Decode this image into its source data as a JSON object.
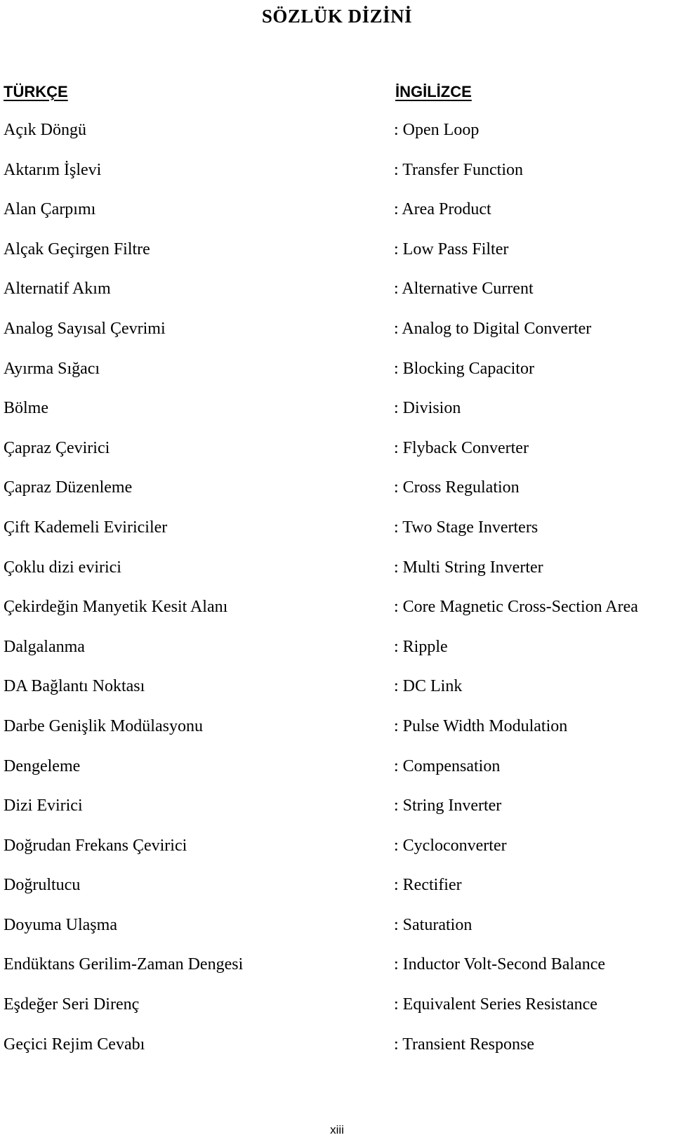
{
  "document": {
    "title": "SÖZLÜK DİZİNİ",
    "page_number": "xiii"
  },
  "columns": {
    "turkish_header": "TÜRKÇE",
    "english_header": "İNGİLİZCE"
  },
  "entries": [
    {
      "tr": "Açık Döngü",
      "en": ": Open Loop"
    },
    {
      "tr": "Aktarım İşlevi",
      "en": ": Transfer Function"
    },
    {
      "tr": "Alan Çarpımı",
      "en": ": Area Product"
    },
    {
      "tr": "Alçak Geçirgen Filtre",
      "en": ": Low Pass Filter"
    },
    {
      "tr": "Alternatif Akım",
      "en": ": Alternative Current"
    },
    {
      "tr": "Analog Sayısal Çevrimi",
      "en": ": Analog to Digital Converter"
    },
    {
      "tr": "Ayırma Sığacı",
      "en": ": Blocking Capacitor"
    },
    {
      "tr": "Bölme",
      "en": ": Division"
    },
    {
      "tr": "Çapraz Çevirici",
      "en": ": Flyback Converter"
    },
    {
      "tr": "Çapraz Düzenleme",
      "en": ": Cross Regulation"
    },
    {
      "tr": "Çift Kademeli Eviriciler",
      "en": ": Two Stage Inverters"
    },
    {
      "tr": "Çoklu dizi evirici",
      "en": ": Multi String Inverter"
    },
    {
      "tr": "Çekirdeğin Manyetik Kesit Alanı",
      "en": ": Core Magnetic Cross-Section Area"
    },
    {
      "tr": "Dalgalanma",
      "en": ": Ripple"
    },
    {
      "tr": "DA Bağlantı Noktası",
      "en": ": DC Link"
    },
    {
      "tr": "Darbe Genişlik Modülasyonu",
      "en": ": Pulse Width Modulation"
    },
    {
      "tr": "Dengeleme",
      "en": ": Compensation"
    },
    {
      "tr": "Dizi Evirici",
      "en": ": String Inverter"
    },
    {
      "tr": "Doğrudan Frekans Çevirici",
      "en": ": Cycloconverter"
    },
    {
      "tr": "Doğrultucu",
      "en": ": Rectifier"
    },
    {
      "tr": "Doyuma Ulaşma",
      "en": ": Saturation"
    },
    {
      "tr": "Endüktans Gerilim-Zaman Dengesi",
      "en": ": Inductor Volt-Second Balance"
    },
    {
      "tr": "Eşdeğer Seri Direnç",
      "en": ": Equivalent Series Resistance"
    },
    {
      "tr": "Geçici Rejim Cevabı",
      "en": ": Transient Response"
    }
  ]
}
